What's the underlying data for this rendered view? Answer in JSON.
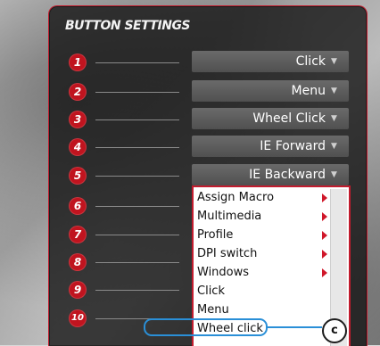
{
  "panel": {
    "title": "BUTTON SETTINGS"
  },
  "rows": [
    {
      "number": "1",
      "value": "Click"
    },
    {
      "number": "2",
      "value": "Menu"
    },
    {
      "number": "3",
      "value": "Wheel Click"
    },
    {
      "number": "4",
      "value": "IE Forward"
    },
    {
      "number": "5",
      "value": "IE Backward"
    },
    {
      "number": "6"
    },
    {
      "number": "7"
    },
    {
      "number": "8"
    },
    {
      "number": "9"
    },
    {
      "number": "10"
    }
  ],
  "dropdown_arrow_icon": "chevron-down-icon",
  "menu": {
    "items": [
      {
        "label": "Assign Macro",
        "submenu": true
      },
      {
        "label": "Multimedia",
        "submenu": true
      },
      {
        "label": "Profile",
        "submenu": true
      },
      {
        "label": "DPI switch",
        "submenu": true
      },
      {
        "label": "Windows",
        "submenu": true
      },
      {
        "label": "Click",
        "submenu": false
      },
      {
        "label": "Menu",
        "submenu": false
      },
      {
        "label": "Wheel click",
        "submenu": false,
        "highlighted": true
      }
    ]
  },
  "callout": {
    "label": "c"
  },
  "colors": {
    "accent_red": "#c21c2e",
    "highlight_blue": "#2a8fd7"
  }
}
